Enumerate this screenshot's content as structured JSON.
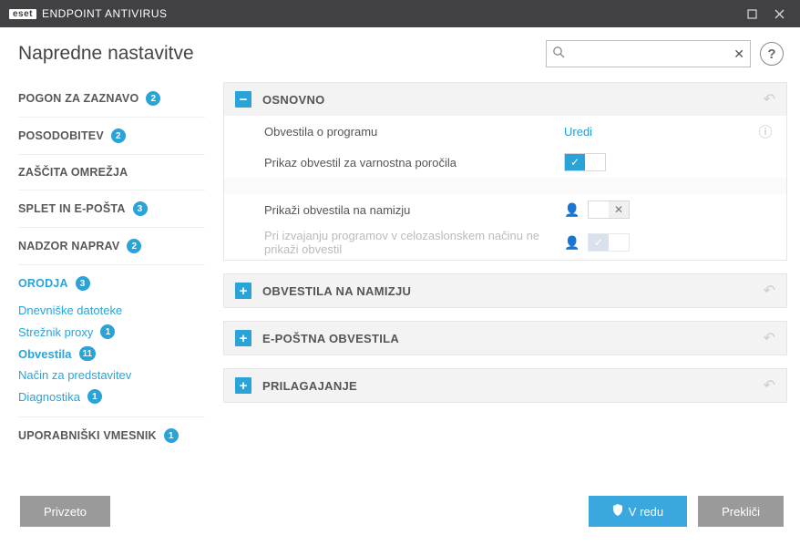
{
  "titlebar": {
    "brand_boxed": "eset",
    "brand_text": "ENDPOINT ANTIVIRUS"
  },
  "header": {
    "title": "Napredne nastavitve",
    "search_placeholder": ""
  },
  "sidebar": {
    "items": [
      {
        "label": "POGON ZA ZAZNAVO",
        "badge": "2"
      },
      {
        "label": "POSODOBITEV",
        "badge": "2"
      },
      {
        "label": "ZAŠČITA OMREŽJA",
        "badge": ""
      },
      {
        "label": "SPLET IN E-POŠTA",
        "badge": "3"
      },
      {
        "label": "NADZOR NAPRAV",
        "badge": "2"
      },
      {
        "label": "ORODJA",
        "badge": "3"
      }
    ],
    "subs": [
      {
        "label": "Dnevniške datoteke",
        "badge": ""
      },
      {
        "label": "Strežnik proxy",
        "badge": "1"
      },
      {
        "label": "Obvestila",
        "badge": "11",
        "active": true
      },
      {
        "label": "Način za predstavitev",
        "badge": ""
      },
      {
        "label": "Diagnostika",
        "badge": "1"
      }
    ],
    "last": {
      "label": "UPORABNIŠKI VMESNIK",
      "badge": "1"
    }
  },
  "sections": {
    "basic": {
      "title": "OSNOVNO",
      "rows": {
        "r1": {
          "label": "Obvestila o programu",
          "link": "Uredi"
        },
        "r2": {
          "label": "Prikaz obvestil za varnostna poročila"
        },
        "r3": {
          "label": "Prikaži obvestila na namizju"
        },
        "r4": {
          "label": "Pri izvajanju programov v celozaslonskem načinu ne prikaži obvestil"
        }
      }
    },
    "desktop": {
      "title": "OBVESTILA NA NAMIZJU"
    },
    "email": {
      "title": "E-POŠTNA OBVESTILA"
    },
    "custom": {
      "title": "PRILAGAJANJE"
    }
  },
  "footer": {
    "default": "Privzeto",
    "ok": "V redu",
    "cancel": "Prekliči"
  }
}
